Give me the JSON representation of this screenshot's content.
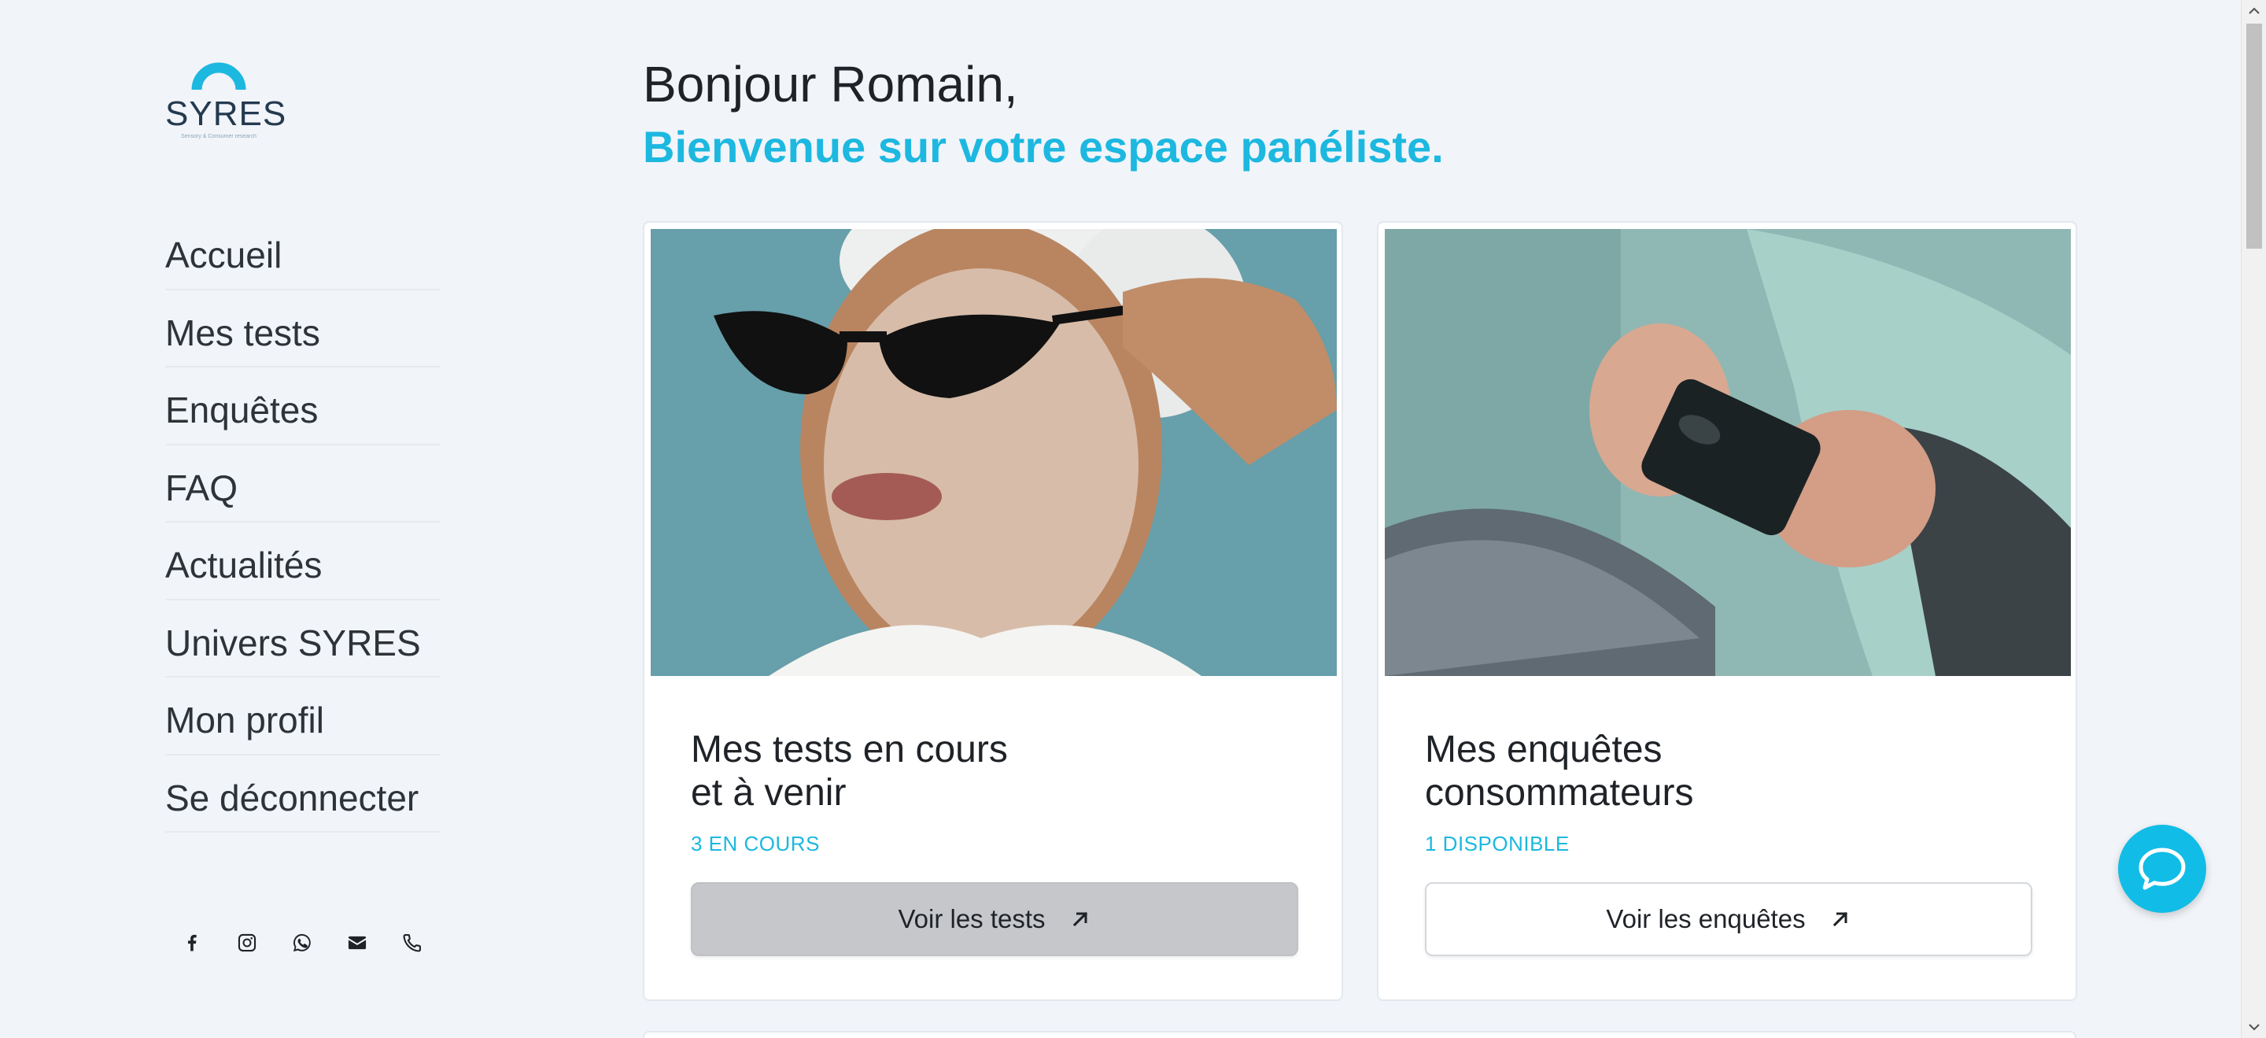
{
  "logo": {
    "word": "SYRES",
    "tagline": "Sensory & Consumer research"
  },
  "nav": {
    "items": [
      {
        "label": "Accueil"
      },
      {
        "label": "Mes tests"
      },
      {
        "label": "Enquêtes"
      },
      {
        "label": "FAQ"
      },
      {
        "label": "Actualités"
      },
      {
        "label": "Univers SYRES"
      },
      {
        "label": "Mon profil"
      },
      {
        "label": "Se déconnecter"
      }
    ]
  },
  "social": [
    "facebook-icon",
    "instagram-icon",
    "whatsapp-icon",
    "email-icon",
    "phone-icon"
  ],
  "header": {
    "greeting": "Bonjour Romain,",
    "welcome": "Bienvenue sur votre espace panéliste."
  },
  "cards": [
    {
      "title_line1": "Mes tests en cours",
      "title_line2": "et à venir",
      "count": "3 EN COURS",
      "button": "Voir les tests"
    },
    {
      "title_line1": "Mes enquêtes",
      "title_line2": "consommateurs",
      "count": "1 DISPONIBLE",
      "button": "Voir les enquêtes"
    }
  ],
  "colors": {
    "accent": "#1cb8e0",
    "background": "#f1f4f9",
    "chat": "#11bde7"
  }
}
